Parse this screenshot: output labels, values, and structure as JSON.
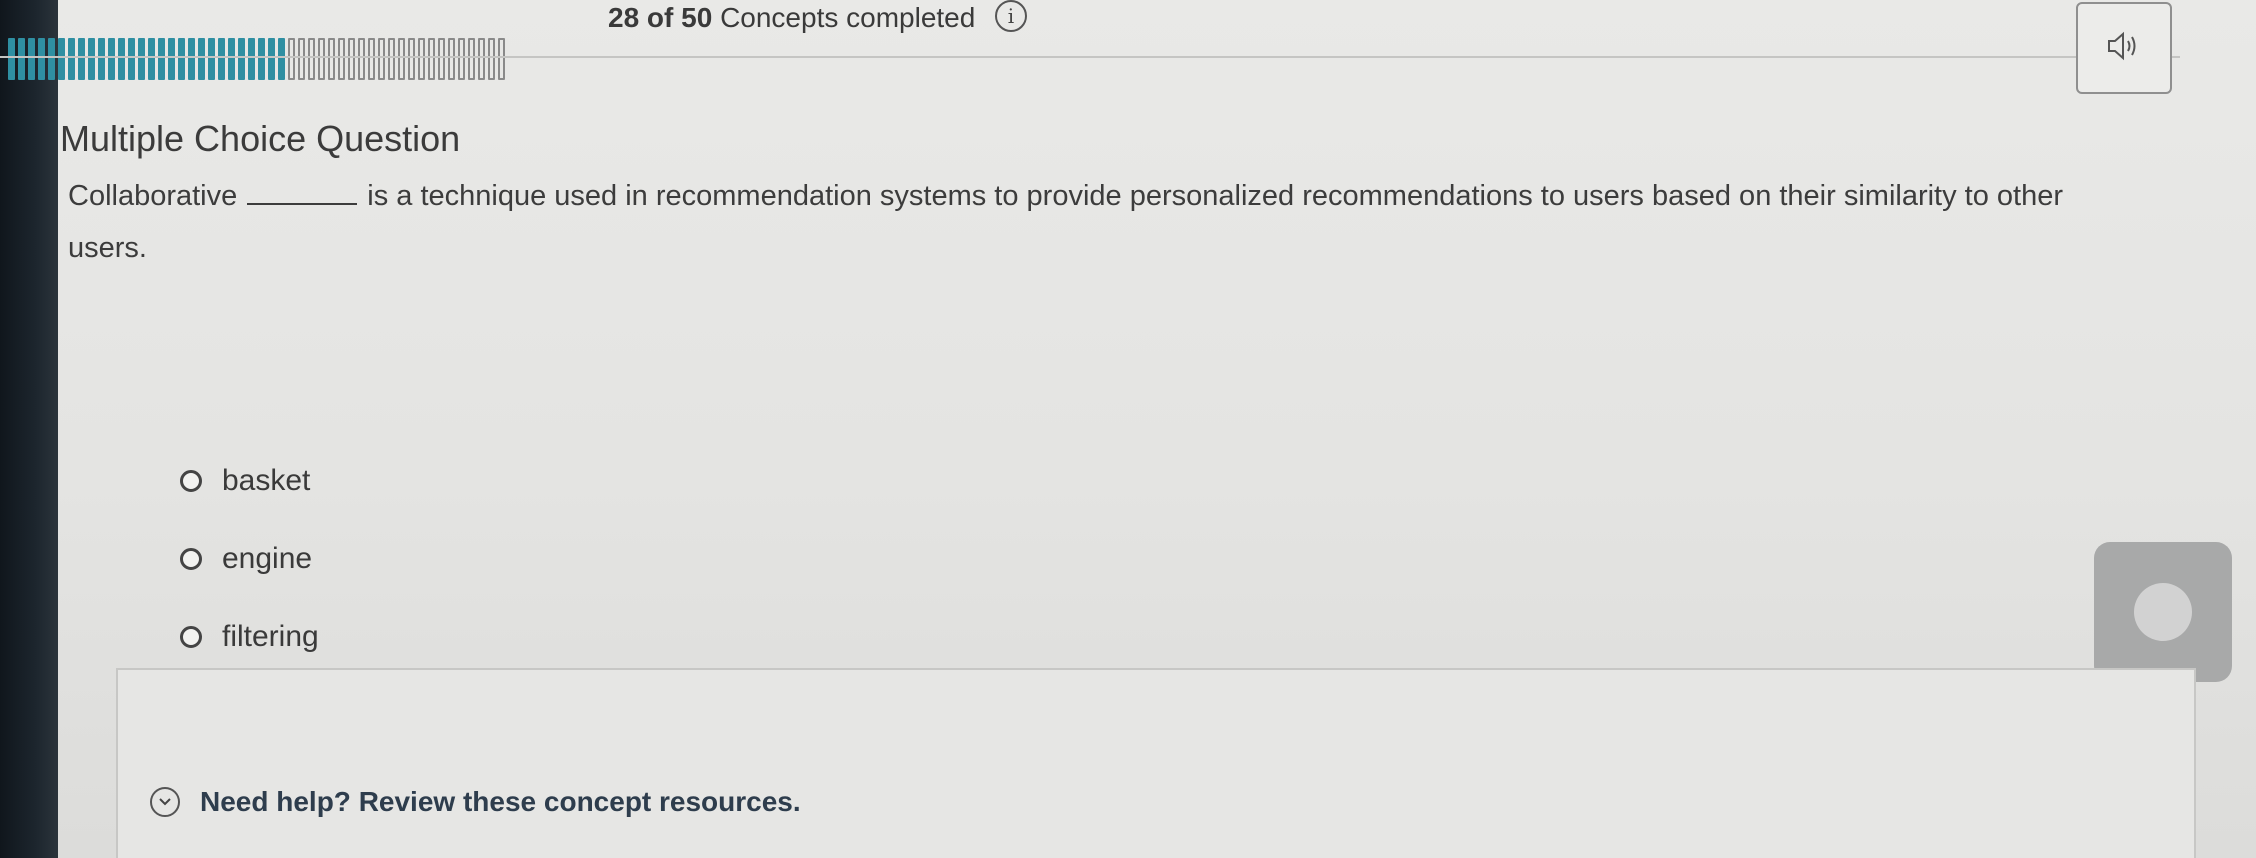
{
  "progress": {
    "completed": 28,
    "total": 50,
    "count_text": "28 of 50",
    "label": "Concepts completed",
    "fill_color": "#2f8fa2"
  },
  "icons": {
    "info": "i",
    "audio": "speaker-icon",
    "chevron": "chevron-down-icon"
  },
  "question": {
    "type": "Multiple Choice Question",
    "prompt_before": "Collaborative",
    "prompt_after": "is a technique used in recommendation systems to provide personalized recommendations to users based on their similarity to other users.",
    "options": [
      "basket",
      "engine",
      "filtering"
    ]
  },
  "help": {
    "label": "Need help? Review these concept resources."
  }
}
